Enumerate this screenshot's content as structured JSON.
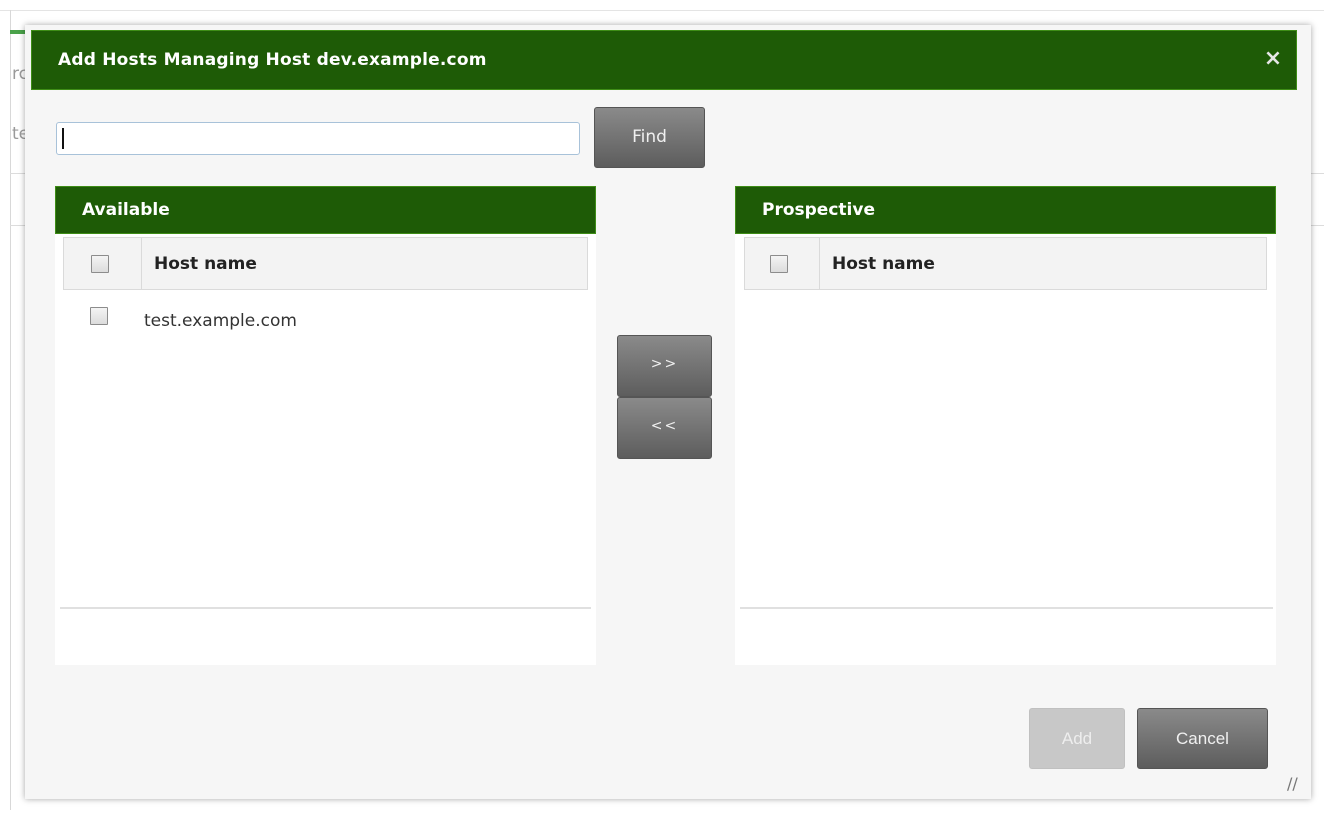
{
  "background": {
    "text_1": "rc",
    "text_2": "te"
  },
  "dialog": {
    "title": "Add Hosts Managing Host dev.example.com",
    "close_icon": "×",
    "search": {
      "value": "",
      "placeholder": ""
    },
    "find_label": "Find",
    "available": {
      "title": "Available",
      "column_header": "Host name",
      "rows": [
        "test.example.com"
      ]
    },
    "prospective": {
      "title": "Prospective",
      "column_header": "Host name",
      "rows": []
    },
    "move_right_label": ">>",
    "move_left_label": "<<",
    "add_label": "Add",
    "cancel_label": "Cancel",
    "resize_icon": "//"
  },
  "colors": {
    "header_green": "#1e5b06",
    "header_border": "#3e8d16",
    "button_dark": "#6b6b6b",
    "button_disabled": "#c8c8c8"
  }
}
